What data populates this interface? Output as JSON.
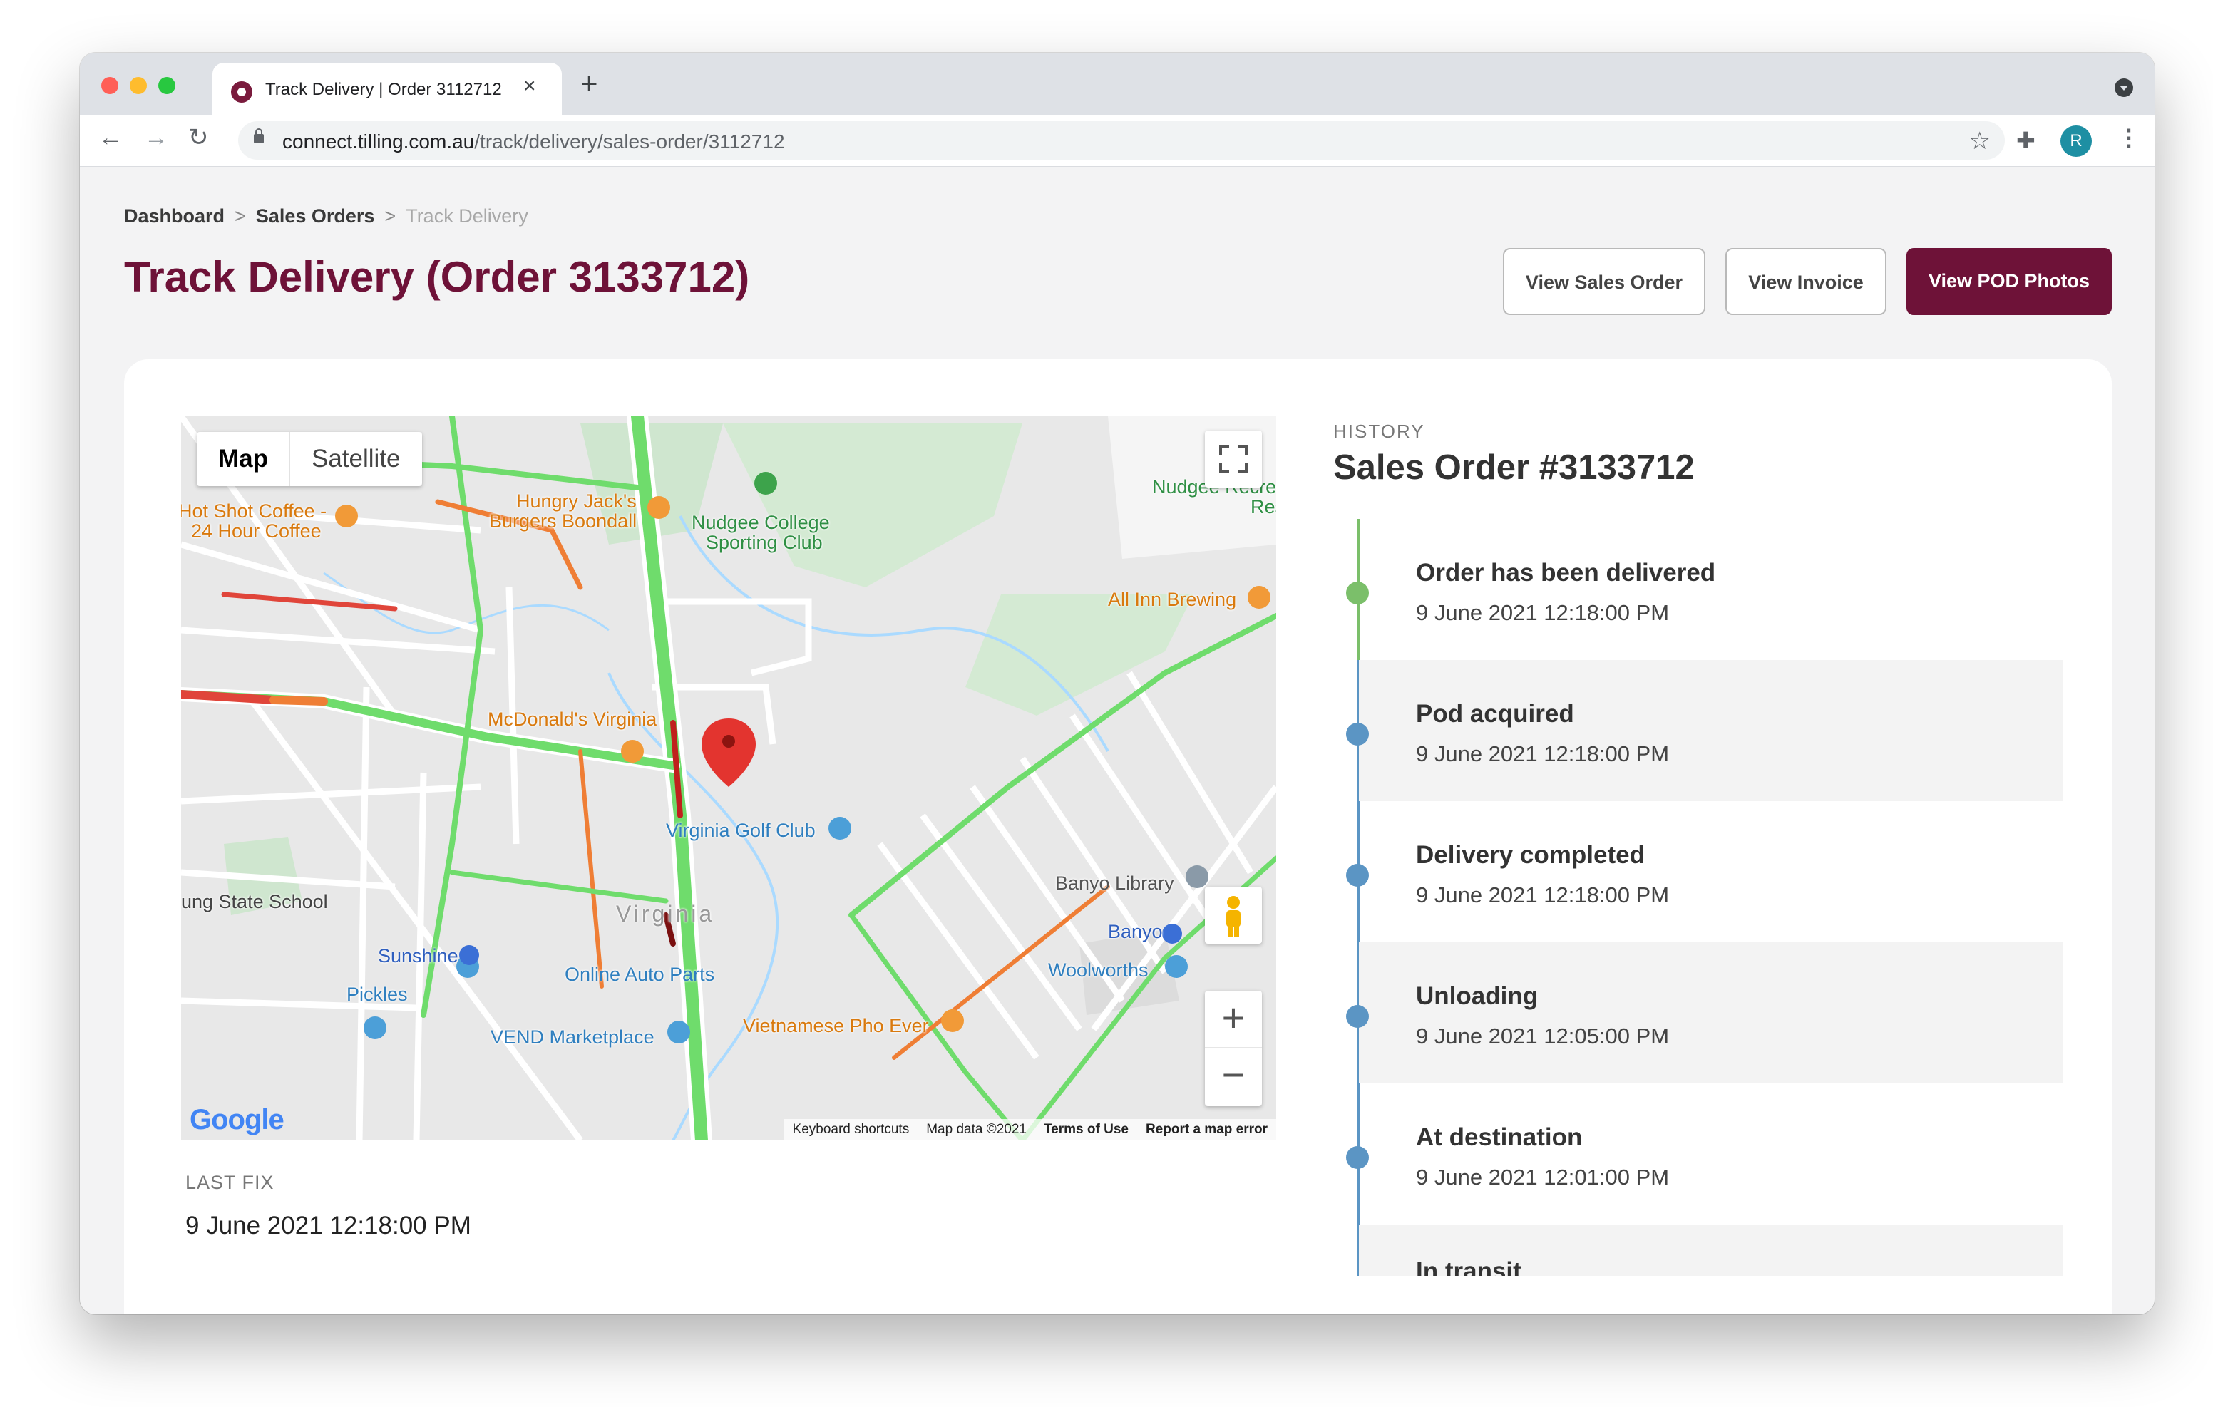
{
  "browser": {
    "tab_title": "Track Delivery | Order 3112712",
    "url_host": "connect.tilling.com.au",
    "url_path": "/track/delivery/sales-order/3112712",
    "profile_initial": "R"
  },
  "breadcrumb": {
    "items": [
      "Dashboard",
      "Sales Orders"
    ],
    "current": "Track Delivery",
    "separator": ">"
  },
  "page": {
    "title": "Track Delivery (Order 3133712)"
  },
  "actions": {
    "view_sales_order": "View Sales Order",
    "view_invoice": "View Invoice",
    "view_pod_photos": "View POD Photos"
  },
  "map": {
    "type_map": "Map",
    "type_satellite": "Satellite",
    "zoom_in": "+",
    "zoom_out": "−",
    "logo": "Google",
    "footer": {
      "shortcuts": "Keyboard shortcuts",
      "map_data": "Map data ©2021",
      "terms": "Terms of Use",
      "report": "Report a map error"
    },
    "places": [
      "Hungry Jack's",
      "Burgers Boondall",
      "Nudgee College",
      "Sporting Club",
      "Hot Shot Coffee -",
      "24 Hour Coffee",
      "Nudgee Recre",
      "Res",
      "All Inn Brewing",
      "McDonald's Virginia",
      "Virginia Golf Club",
      "Banyo Library",
      "Banyo",
      "Woolworths",
      "Virginia",
      "Sunshine",
      "Online Auto Parts",
      "Pickles",
      "VEND Marketplace",
      "Vietnamese Pho Ever",
      "ung State School"
    ]
  },
  "last_fix": {
    "label": "LAST FIX",
    "value": "9 June 2021 12:18:00 PM"
  },
  "history": {
    "label": "HISTORY",
    "title": "Sales Order #3133712",
    "events": [
      {
        "title": "Order has been delivered",
        "time": "9 June 2021 12:18:00 PM"
      },
      {
        "title": "Pod acquired",
        "time": "9 June 2021 12:18:00 PM"
      },
      {
        "title": "Delivery completed",
        "time": "9 June 2021 12:18:00 PM"
      },
      {
        "title": "Unloading",
        "time": "9 June 2021 12:05:00 PM"
      },
      {
        "title": "At destination",
        "time": "9 June 2021 12:01:00 PM"
      },
      {
        "title": "In transit",
        "time": ""
      }
    ]
  },
  "colors": {
    "brand": "#6e1238",
    "timeline_done": "#7bbf6a",
    "timeline": "#5b95c4"
  }
}
